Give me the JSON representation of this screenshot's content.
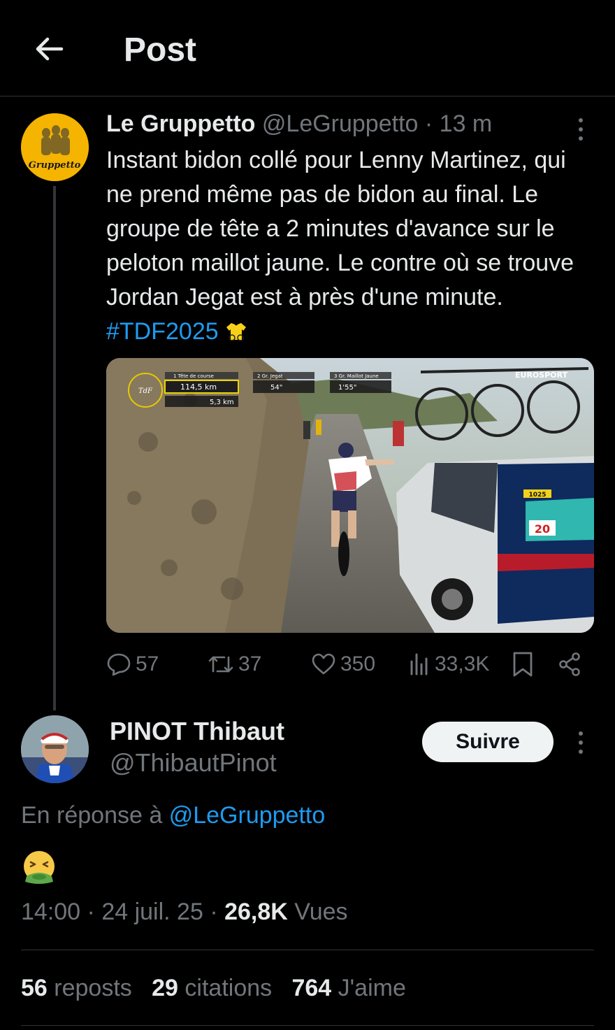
{
  "header": {
    "title": "Post"
  },
  "tweet": {
    "author_name": "Le Gruppetto",
    "author_handle": "@LeGruppetto",
    "time_sep": "·",
    "time": "13 m",
    "avatar_text": "Gruppetto",
    "text_main": "Instant bidon collé pour Lenny Martinez, qui ne prend même pas de bidon au final. Le groupe de tête a 2 minutes d'avance sur le peloton maillot jaune. Le contre où se trouve Jordan Jegat est à près d'une minute.",
    "hashtag": "#TDF2025",
    "media_overlay": {
      "seg1_label": "1 Tête de course",
      "seg1_distance": "114,5 km",
      "seg1_remaining": "5,3 km",
      "seg2_label": "2 Gr. Jegat",
      "seg2_gap": "54\"",
      "seg3_label": "3 Gr. Maillot Jaune",
      "seg3_gap": "1'55\"",
      "broadcaster": "EUROSPORT",
      "car_number": "20",
      "car_plate": "1025"
    },
    "actions": {
      "replies": "57",
      "reposts": "37",
      "likes": "350",
      "views": "33,3K"
    }
  },
  "reply": {
    "author_name": "PINOT Thibaut",
    "author_handle": "@ThibautPinot",
    "follow_label": "Suivre",
    "reply_prefix": "En réponse à",
    "reply_mention": "@LeGruppetto",
    "emoji": "nauseated-face",
    "time": "14:00",
    "sep1": "·",
    "date": "24 juil. 25",
    "sep2": "·",
    "views_count": "26,8K",
    "views_label": "Vues"
  },
  "stats": {
    "reposts_count": "56",
    "reposts_label": "reposts",
    "quotes_count": "29",
    "quotes_label": "citations",
    "likes_count": "764",
    "likes_label": "J'aime"
  },
  "colors": {
    "background": "#000000",
    "text": "#e7e9ea",
    "secondary": "#71767b",
    "link": "#1d9bf0",
    "follow_bg": "#eff3f4"
  }
}
